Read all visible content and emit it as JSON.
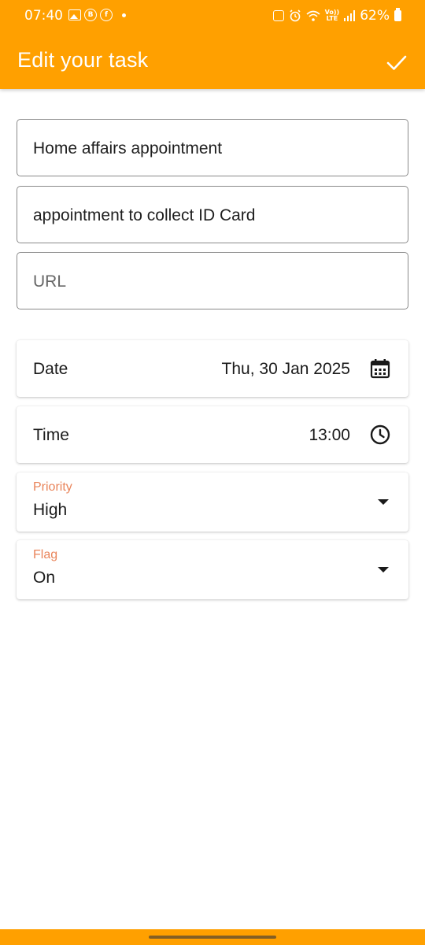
{
  "status_bar": {
    "time": "07:40",
    "battery": "62%",
    "left_icons": [
      "gallery-icon",
      "b-icon",
      "facebook-icon"
    ],
    "right_icons": [
      "sync-icon",
      "alarm-icon",
      "wifi-icon",
      "volte-icon",
      "signal-icon",
      "battery-icon"
    ],
    "volte_text_1": "Vo))",
    "volte_text_2": "LTE"
  },
  "app_bar": {
    "title": "Edit your task",
    "save_icon": "check-icon",
    "color": "#FFA000"
  },
  "form": {
    "title_value": "Home affairs appointment",
    "description_value": "appointment to collect ID Card",
    "url_placeholder": "URL"
  },
  "date_row": {
    "label": "Date",
    "value": "Thu, 30 Jan 2025",
    "icon": "calendar-icon"
  },
  "time_row": {
    "label": "Time",
    "value": "13:00",
    "icon": "clock-icon"
  },
  "priority": {
    "label": "Priority",
    "value": "High"
  },
  "flag": {
    "label": "Flag",
    "value": "On"
  },
  "colors": {
    "accent": "#FFA000",
    "floating_label": "#E9845A"
  }
}
